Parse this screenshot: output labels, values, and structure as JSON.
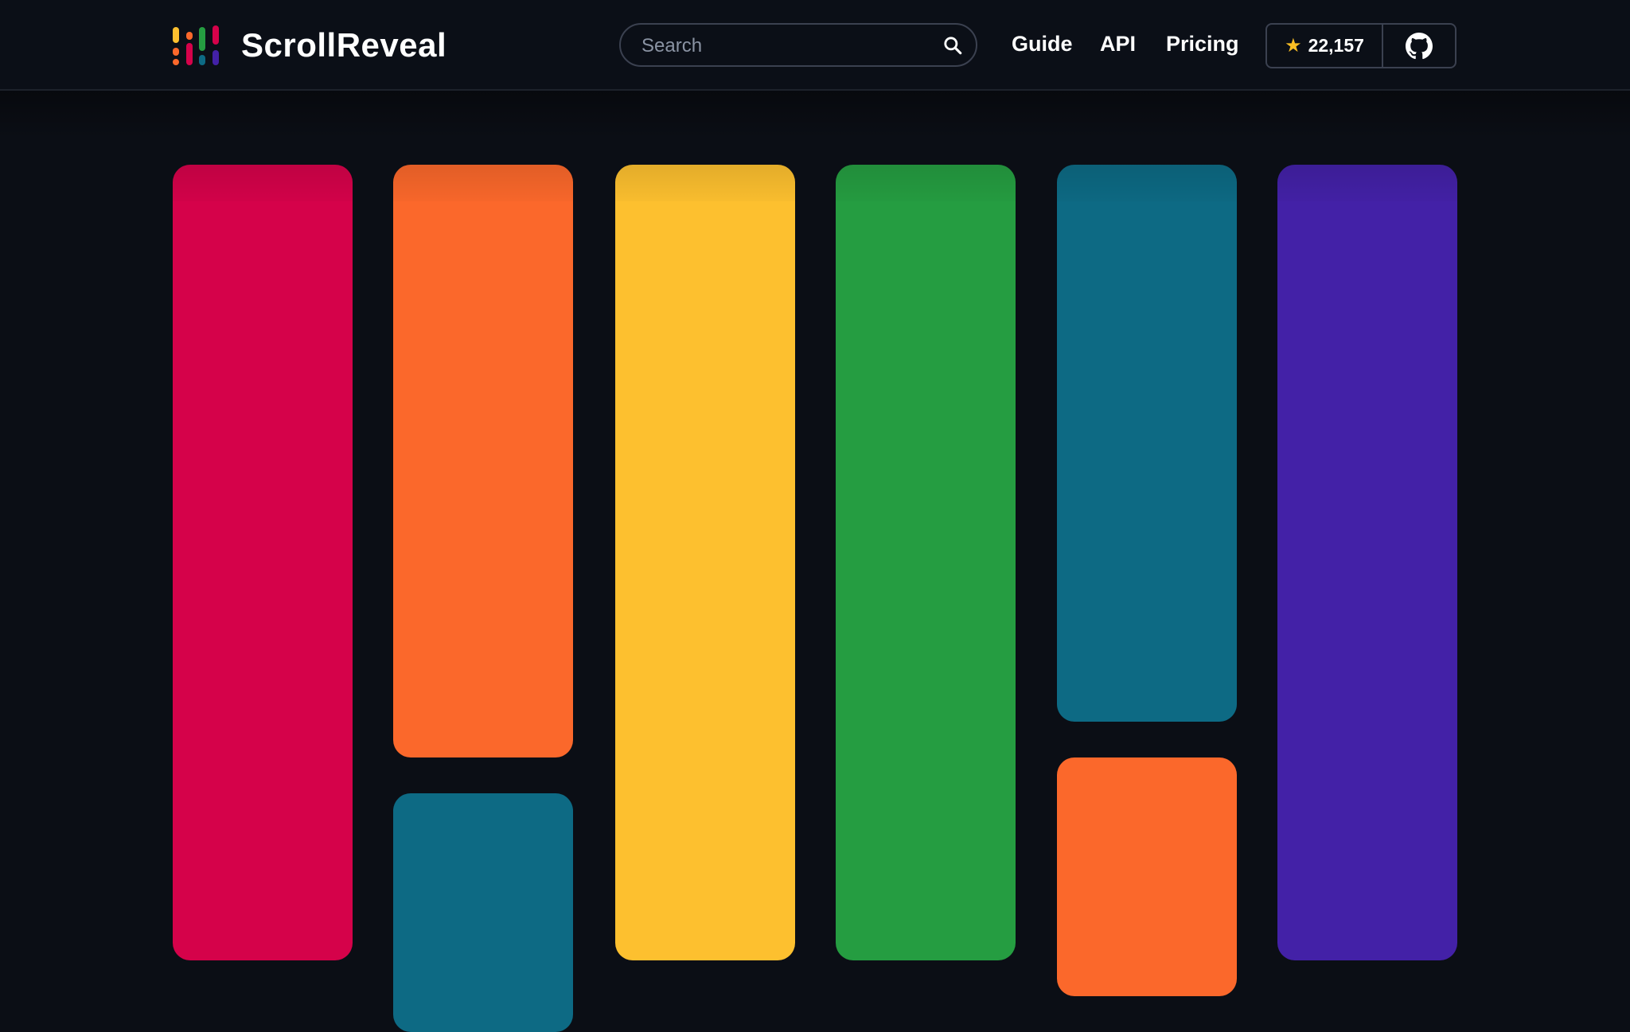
{
  "header": {
    "brand": "ScrollReveal",
    "search": {
      "placeholder": "Search",
      "value": ""
    },
    "nav": [
      "Guide",
      "API",
      "Pricing"
    ],
    "star_count": "22,157",
    "icons": [
      "search-icon",
      "star-icon",
      "github-icon"
    ]
  },
  "colors": {
    "background": "#0b0e15",
    "crimson": "#d5024a",
    "orange": "#fb682b",
    "yellow": "#fdc02f",
    "green": "#259d41",
    "teal": "#0d6a84",
    "purple": "#4321a7",
    "star": "#fbbf24"
  },
  "blocks": [
    {
      "name": "crimson",
      "color": "#d5024a"
    },
    {
      "name": "orange",
      "color": "#fb682b"
    },
    {
      "name": "teal",
      "color": "#0d6a84"
    },
    {
      "name": "yellow",
      "color": "#fdc02f"
    },
    {
      "name": "green",
      "color": "#259d41"
    },
    {
      "name": "teal",
      "color": "#0d6a84"
    },
    {
      "name": "orange",
      "color": "#fb682b"
    },
    {
      "name": "purple",
      "color": "#4321a7"
    }
  ]
}
